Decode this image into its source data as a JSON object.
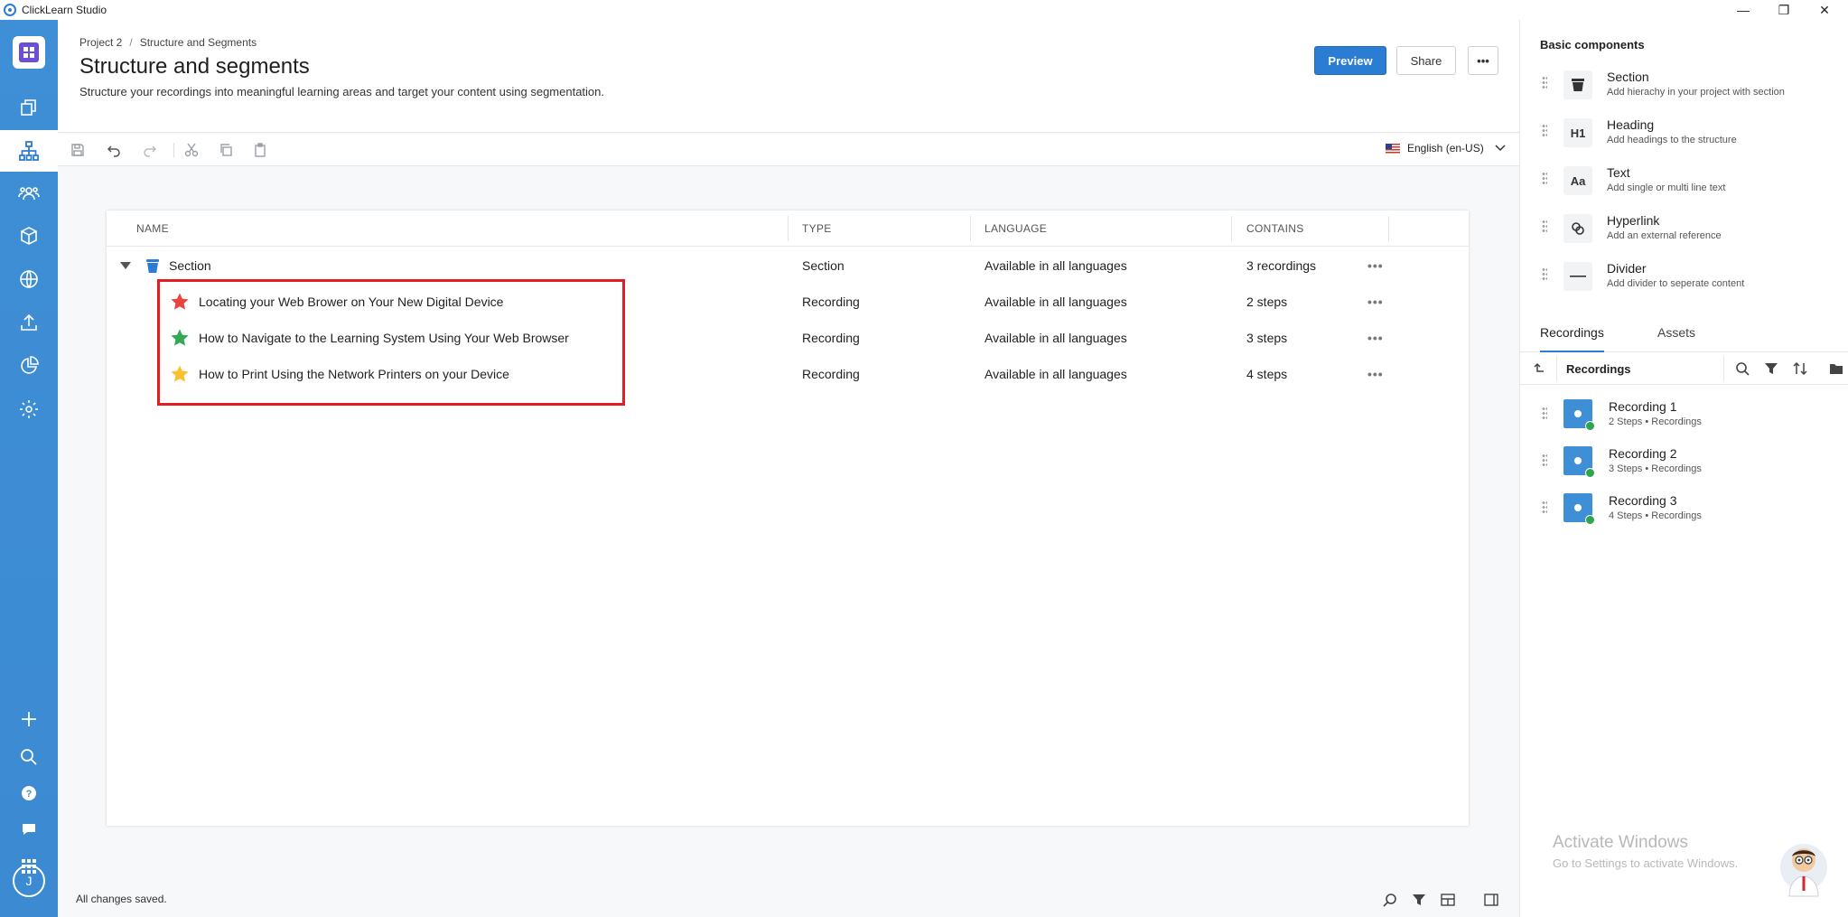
{
  "window": {
    "title": "ClickLearn Studio",
    "minimize": "—",
    "restore": "❐",
    "close": "✕"
  },
  "rail": {
    "avatar": "J"
  },
  "header": {
    "breadcrumb": [
      "Project 2",
      "Structure and Segments"
    ],
    "breadcrumb_sep": "/",
    "title": "Structure and segments",
    "subtitle": "Structure your recordings into meaningful learning areas and target your content using segmentation.",
    "preview_label": "Preview",
    "share_label": "Share",
    "more_label": "•••"
  },
  "toolbar": {
    "language": "English (en-US)"
  },
  "grid": {
    "columns": [
      "NAME",
      "TYPE",
      "LANGUAGE",
      "CONTAINS"
    ],
    "section": {
      "name": "Section",
      "type": "Section",
      "language": "Available in all languages",
      "contains": "3 recordings"
    },
    "rows": [
      {
        "name": "Locating your Web Brower on Your New Digital Device",
        "type": "Recording",
        "language": "Available in all languages",
        "contains": "2 steps",
        "star_color": "#e8453c"
      },
      {
        "name": "How to Navigate to the Learning System Using Your Web Browser",
        "type": "Recording",
        "language": "Available in all languages",
        "contains": "3 steps",
        "star_color": "#34a853"
      },
      {
        "name": "How to Print Using the Network Printers on your Device",
        "type": "Recording",
        "language": "Available in all languages",
        "contains": "4 steps",
        "star_color": "#fbc02d"
      }
    ],
    "row_more": "•••",
    "highlight_color": "#e31b23"
  },
  "status": {
    "message": "All changes saved."
  },
  "right_panel": {
    "heading": "Basic components",
    "components": [
      {
        "title": "Section",
        "desc": "Add hierachy in your project with section",
        "icon": "section-bin-icon"
      },
      {
        "title": "Heading",
        "desc": "Add headings to the structure",
        "icon": "H1"
      },
      {
        "title": "Text",
        "desc": "Add single or multi line text",
        "icon": "Aa"
      },
      {
        "title": "Hyperlink",
        "desc": "Add an external reference",
        "icon": "link-icon"
      },
      {
        "title": "Divider",
        "desc": "Add divider to seperate content",
        "icon": "divider-icon"
      }
    ],
    "tabs": [
      "Recordings",
      "Assets"
    ],
    "folder": "Recordings",
    "recordings": [
      {
        "title": "Recording 1",
        "meta": "2 Steps • Recordings"
      },
      {
        "title": "Recording 2",
        "meta": "3 Steps • Recordings"
      },
      {
        "title": "Recording 3",
        "meta": "4 Steps • Recordings"
      }
    ]
  },
  "watermark": {
    "line1": "Activate Windows",
    "line2": "Go to Settings to activate Windows."
  },
  "colors": {
    "accent": "#2b7cd3",
    "rail": "#3f8fd6"
  }
}
